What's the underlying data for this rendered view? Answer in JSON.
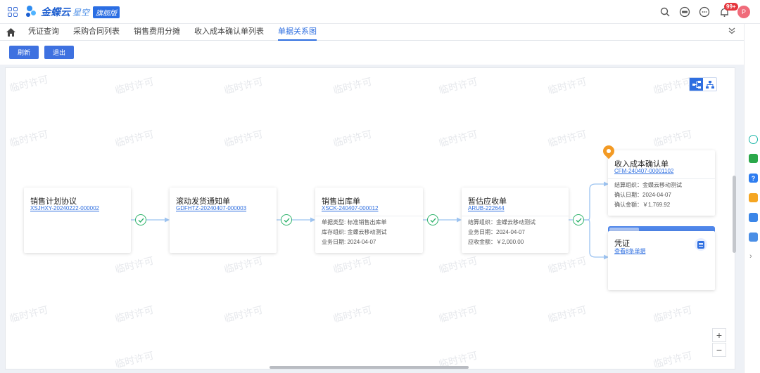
{
  "app": {
    "brand": "金蝶云",
    "brand_sub": "星空",
    "edition": "旗舰版",
    "notification_count": "99+",
    "avatar_initial": "P"
  },
  "tabs": [
    "凭证查询",
    "采购合同列表",
    "销售费用分摊",
    "收入成本确认单列表",
    "单据关系图"
  ],
  "active_tab": "单据关系图",
  "toolbar": {
    "refresh": "刷新",
    "exit": "退出"
  },
  "watermark": "临时许可",
  "nodes": {
    "plan": {
      "title": "销售计划协议",
      "code": "XSJHXY-20240222-000002"
    },
    "notice": {
      "title": "滚动发货通知单",
      "code": "GDFHTZ-20240407-000003"
    },
    "outbound": {
      "title": "销售出库单",
      "code": "XSCK-240407-000012",
      "fields": [
        "单据类型: 标准销售出库单",
        "库存组织: 金蝶云移动测试",
        "业务日期: 2024-04-07"
      ]
    },
    "receivable": {
      "title": "暂估应收单",
      "code": "ARUB-222644",
      "fields": [
        "结算组织：金蝶云移动测试",
        "业务日期：2024-04-07",
        "应收金额：￥2,000.00"
      ]
    },
    "confirm": {
      "title": "收入成本确认单",
      "code": "CFM-240407-00001102",
      "fields": [
        "结算组织：金蝶云移动测试",
        "确认日期：2024-04-07",
        "确认金额：￥1,769.92"
      ]
    },
    "voucher": {
      "title": "凭证",
      "link": "查看8条单据"
    }
  },
  "zoom": {
    "in": "+",
    "out": "−"
  },
  "colors": {
    "accent": "#2f6fe0",
    "check": "#2fb36b",
    "pin": "#f39a24",
    "badge": "#e5363d"
  }
}
